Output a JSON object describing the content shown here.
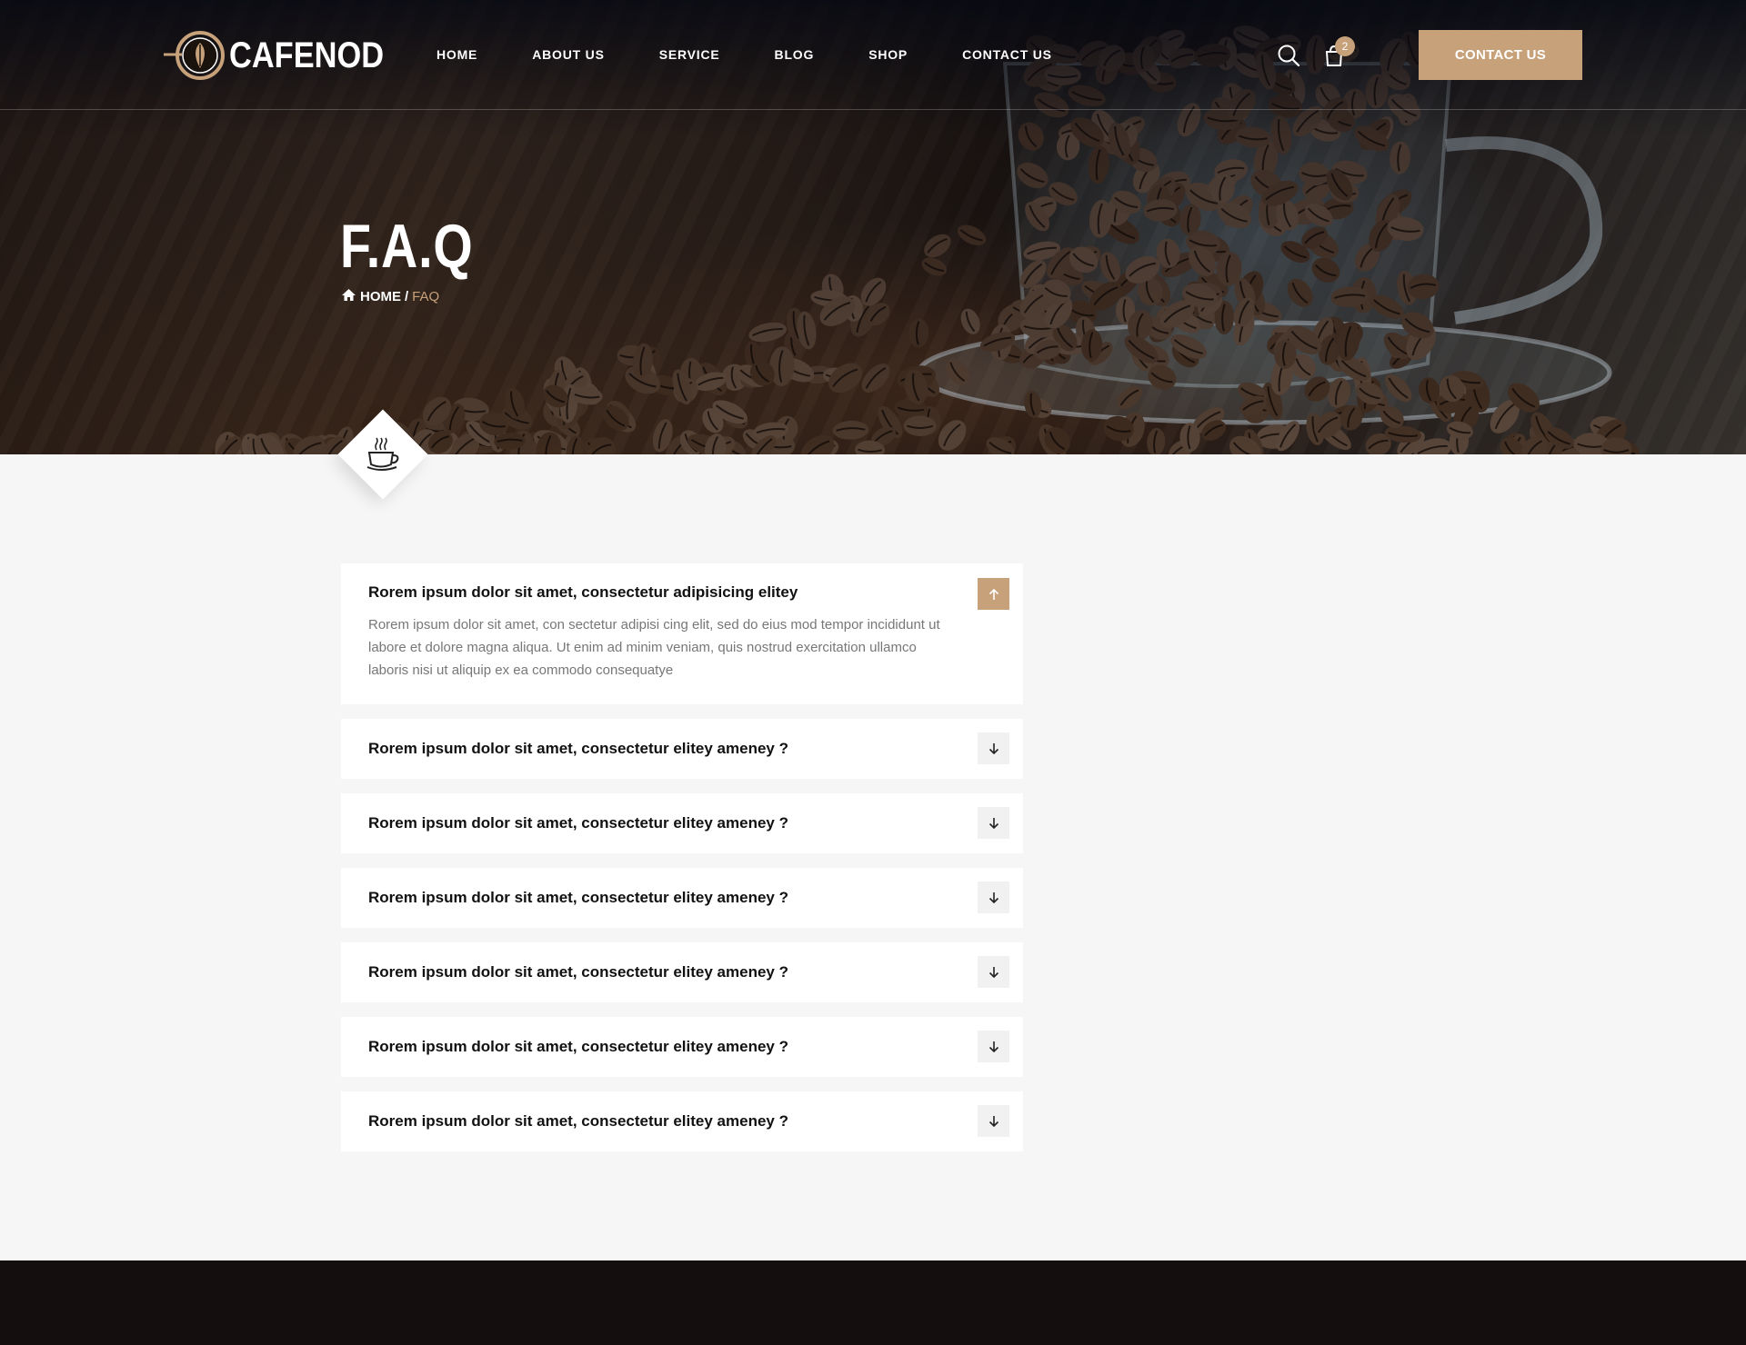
{
  "brand": {
    "name": "CAFENOD",
    "accent": "#c7a17a",
    "dark": "#0b0d16"
  },
  "nav": [
    {
      "label": "HOME"
    },
    {
      "label": "ABOUT US"
    },
    {
      "label": "SERVICE"
    },
    {
      "label": "BLOG"
    },
    {
      "label": "SHOP"
    },
    {
      "label": "CONTACT US"
    }
  ],
  "header": {
    "cart_count": "2",
    "contact_label": "CONTACT US",
    "search_icon": "search-icon",
    "cart_icon": "shopping-bag-icon"
  },
  "hero": {
    "title": "F.A.Q",
    "breadcrumb_home": "HOME",
    "breadcrumb_sep": "/",
    "breadcrumb_current": "FAQ"
  },
  "faq": [
    {
      "question": "Rorem ipsum dolor sit amet, consectetur adipisicing elitey",
      "answer": "Rorem ipsum dolor  sit amet, con sectetur adipisi cing elit, sed do eius mod tempor incididunt ut labore et dolore magna aliqua. Ut enim ad minim veniam, quis nostrud exercitation ullamco laboris nisi ut aliquip ex ea commodo consequatye",
      "open": true
    },
    {
      "question": "Rorem ipsum dolor sit amet, consectetur elitey ameney ?",
      "open": false
    },
    {
      "question": "Rorem ipsum dolor sit amet, consectetur elitey ameney ?",
      "open": false
    },
    {
      "question": "Rorem ipsum dolor sit amet, consectetur elitey ameney ?",
      "open": false
    },
    {
      "question": "Rorem ipsum dolor sit amet, consectetur elitey ameney ?",
      "open": false
    },
    {
      "question": "Rorem ipsum dolor sit amet, consectetur elitey ameney ?",
      "open": false
    },
    {
      "question": "Rorem ipsum dolor sit amet, consectetur elitey ameney ?",
      "open": false
    }
  ]
}
